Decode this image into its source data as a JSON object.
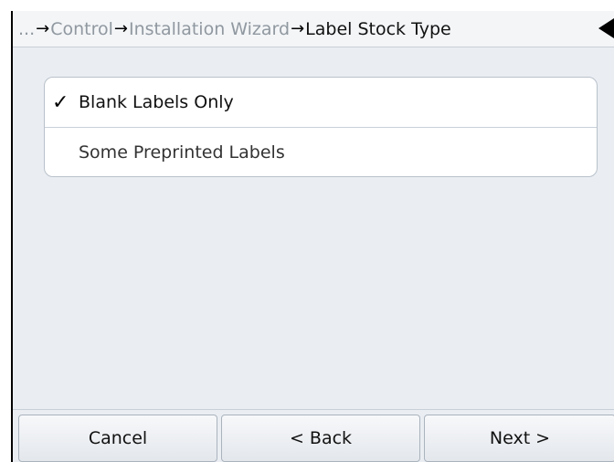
{
  "breadcrumb": {
    "ellipsis": "...",
    "separator": "→",
    "items": [
      "Control",
      "Installation Wizard"
    ],
    "current": "Label Stock Type",
    "back_icon": "triangle-left-icon"
  },
  "options": [
    {
      "label": "Blank Labels Only",
      "selected": true,
      "check_mark": "✓"
    },
    {
      "label": "Some Preprinted Labels",
      "selected": false
    }
  ],
  "buttons": {
    "cancel": "Cancel",
    "back": "< Back",
    "next": "Next >"
  }
}
